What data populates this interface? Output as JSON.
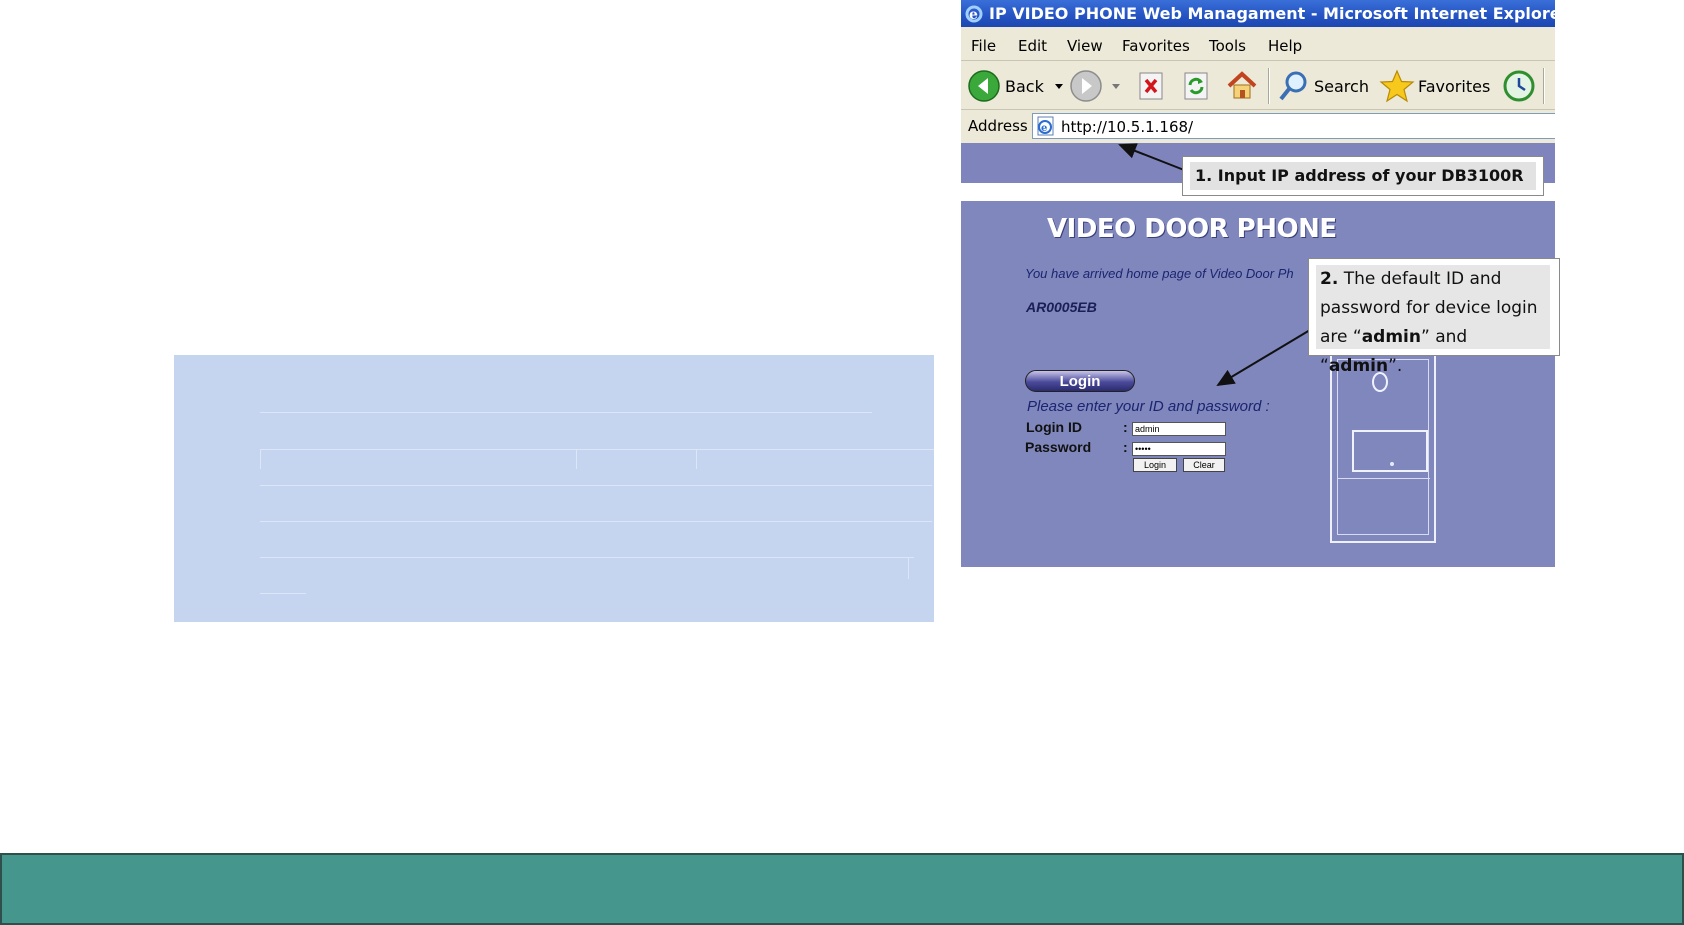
{
  "browser": {
    "title": "IP VIDEO PHONE Web Managament - Microsoft Internet Explorer",
    "menu": [
      "File",
      "Edit",
      "View",
      "Favorites",
      "Tools",
      "Help"
    ],
    "toolbar": {
      "back_label": "Back",
      "search_label": "Search",
      "favorites_label": "Favorites"
    },
    "address_label": "Address",
    "url": "http://10.5.1.168/"
  },
  "page": {
    "title": "VIDEO DOOR PHONE",
    "welcome": "You have arrived home page of Video Door Ph",
    "device_id": "AR0005EB",
    "login_heading": "Login",
    "prompt": "Please enter your ID and password :",
    "login_id_label": "Login ID",
    "password_label": "Password",
    "colon": ":",
    "login_id_value": "admin",
    "password_value": "•••••",
    "login_button": "Login",
    "clear_button": "Clear"
  },
  "callouts": {
    "step1": "1. Input IP address of your DB3100R",
    "step2_num": "2.",
    "step2_a": " The default ID and password for device login are “",
    "step2_b": "admin",
    "step2_c": "” and “",
    "step2_d": "admin",
    "step2_e": "”."
  },
  "colors": {
    "left_panel": "#c6d5ef",
    "footer": "#45968d",
    "content_bg": "#7f87bd",
    "titlebar": "#2453c2"
  }
}
